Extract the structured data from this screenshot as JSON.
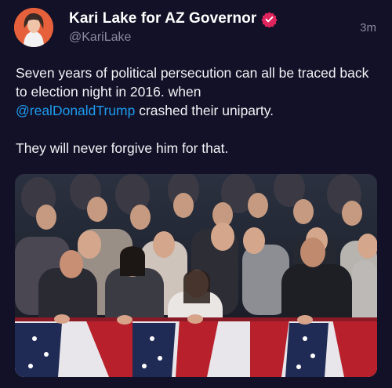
{
  "tweet": {
    "display_name": "Kari Lake for AZ Governor",
    "handle": "@KariLake",
    "timestamp": "3m",
    "text_line1": "Seven years of political persecution can all be traced back to election night in 2016. when",
    "mention": "@realDonaldTrump",
    "text_line1_tail": " crashed their uniparty.",
    "text_line2": "They will never forgive him for that."
  },
  "icons": {
    "verified": "verified-badge-icon"
  },
  "colors": {
    "background": "#131127",
    "mention": "#1d9bf0",
    "verified_badge": "#e0245e",
    "secondary_text": "#8b8aa0"
  }
}
